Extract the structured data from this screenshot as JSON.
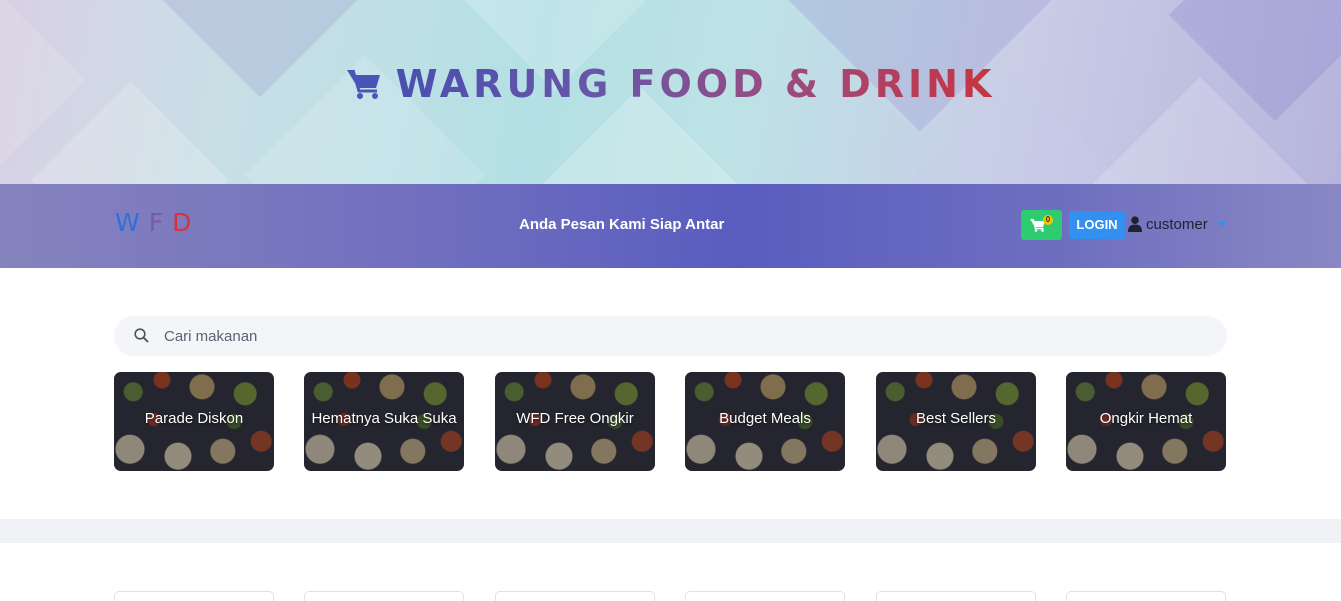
{
  "hero": {
    "title": "WARUNG FOOD & DRINK",
    "icon": "shopping-cart-icon"
  },
  "navbar": {
    "brand": [
      "W",
      "F",
      "D"
    ],
    "brand_colors": [
      "#2f6fd8",
      "#7a5aa6",
      "#d8323a"
    ],
    "tagline": "Anda Pesan Kami Siap Antar",
    "cart_count": "0",
    "login_label": "LOGIN",
    "user_label": "customer"
  },
  "search": {
    "placeholder": "Cari makanan",
    "value": ""
  },
  "categories": [
    {
      "label": "Parade Diskon"
    },
    {
      "label": "Hematnya Suka Suka"
    },
    {
      "label": "WFD Free Ongkir"
    },
    {
      "label": "Budget Meals"
    },
    {
      "label": "Best Sellers"
    },
    {
      "label": "Ongkir Hemat"
    }
  ],
  "colors": {
    "cart_button": "#2ecc71",
    "login_button": "#3490f0",
    "badge": "#f5c400"
  }
}
